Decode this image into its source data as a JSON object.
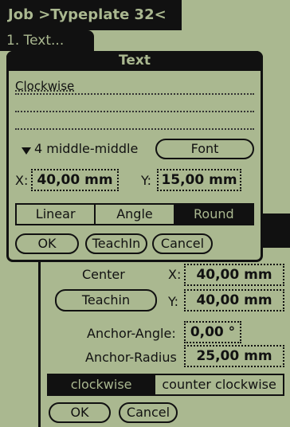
{
  "header": {
    "title": "Job >Typeplate 32<",
    "tab": "1. Text..."
  },
  "round_dialog": {
    "center_label": "Center",
    "teachin_label": "Teachin",
    "x_prefix": "X:",
    "x_value": "40,00 mm",
    "y_prefix": "Y:",
    "y_value": "40,00 mm",
    "anchor_angle_label": "Anchor-Angle:",
    "anchor_angle_value": "0,00 °",
    "anchor_radius_label": "Anchor-Radius",
    "anchor_radius_value": "25,00 mm",
    "direction_options": [
      "clockwise",
      "counter clockwise"
    ],
    "direction_selected": "clockwise",
    "ok_label": "OK",
    "cancel_label": "Cancel"
  },
  "text_dialog": {
    "title": "Text",
    "text_lines": [
      "Clockwise",
      "",
      ""
    ],
    "alignment_value": "4 middle-middle",
    "font_button": "Font",
    "x_prefix": "X:",
    "x_value": "40,00 mm",
    "y_prefix": "Y:",
    "y_value": "15,00 mm",
    "mode_options": [
      "Linear",
      "Angle",
      "Round"
    ],
    "mode_selected": "Round",
    "ok_label": "OK",
    "teachin_label": "TeachIn",
    "cancel_label": "Cancel"
  },
  "colors": {
    "lcd_background": "#aab890",
    "ink": "#111111"
  }
}
